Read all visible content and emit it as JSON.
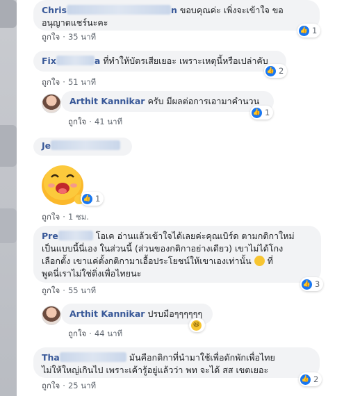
{
  "comments": [
    {
      "id": "c1",
      "name_visible_start": "Chris",
      "name_visible_end": "n",
      "text": "ขอบคุณค่ะ เพิ่งจะเข้าใจ ขออนุญาตแชร์นะคะ",
      "text_line1": "ขอบคุณค่ะ เพิ่งจะเข้าใจ ขอ",
      "text_line2": "อนุญาตแชร์นะคะ",
      "like_label": "ถูกใจ",
      "time": "35 นาที",
      "reaction_count": "1"
    },
    {
      "id": "c2",
      "name_visible_start": "Fix",
      "name_visible_end": "a",
      "text": "ที่ทำให้บัตรเสียเยอะ เพราะเหตุนี้หรือเปล่าคับ",
      "like_label": "ถูกใจ",
      "time": "51 นาที",
      "reaction_count": "2"
    },
    {
      "id": "c3",
      "name": "Arthit Kannikar",
      "text": "ครับ มีผลต่อการเอามาคำนวน",
      "like_label": "ถูกใจ",
      "time": "41 นาที",
      "reaction_count": "1"
    },
    {
      "id": "c4",
      "name_visible_start": "Je",
      "like_label": "ถูกใจ",
      "time": "1 ชม.",
      "reaction_count": "1"
    },
    {
      "id": "c5",
      "name_visible_start": "Pre",
      "text_line1": "โอเค อ่านแล้วเข้าใจได้เลยค่ะคุณเบิร์ด ตามกติกาใหม่",
      "text_line2": "เป็นแบบนี้นี่เอง ในส่วนนี้ (ส่วนของกติกาอย่างเดียว) เขาไม่ได้โกง",
      "text_line3": "เลือกตั้ง เขาแค่ตั้งกติกามาเอื้อประโยชน์ให้เขาเองเท่านั้น",
      "text_line4": "ที่",
      "text_line5": "พูดนี่เราไม่ใช่ติ่งเพื่อไทยนะ",
      "like_label": "ถูกใจ",
      "time": "55 นาที",
      "reaction_count": "3"
    },
    {
      "id": "c6",
      "name": "Arthit Kannikar",
      "text": "ปรบมือๆๆๆๆๆๆ",
      "like_label": "ถูกใจ",
      "time": "44 นาที"
    },
    {
      "id": "c7",
      "name_visible_start": "Tha",
      "text_line1": "มันคือกติกาที่นำมาใช้เพื่อดักพักเพื่อไทย",
      "text_line2": "ไม่ให้ใหญ่เกินไป เพราะเค้ารู้อยู่แล้วว่า พท จะได้ สส เขตเยอะ",
      "like_label": "ถูกใจ",
      "time": "25 นาที",
      "reaction_count": "2"
    }
  ],
  "icons": {
    "like": "thumbs-up-icon",
    "haha": "laughing-face-icon",
    "sticker": "smiling-blob-sticker"
  },
  "colors": {
    "name": "#385898",
    "bubble": "#f2f3f5",
    "like": "#1877f2"
  }
}
